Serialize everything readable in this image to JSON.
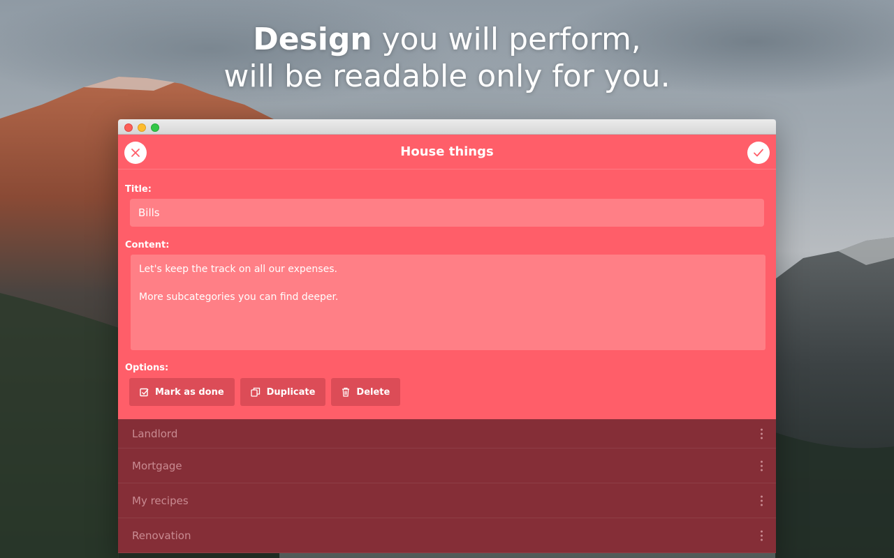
{
  "headline": {
    "bold": "Design",
    "line1_rest": " you will perform,",
    "line2": "will be readable only for you."
  },
  "window": {
    "header": {
      "title": "House things",
      "close_icon": "close-icon",
      "confirm_icon": "check-icon"
    },
    "form": {
      "title_label": "Title:",
      "title_value": "Bills",
      "content_label": "Content:",
      "content_lines": [
        "Let's keep the track on all our expenses.",
        "More subcategories you can find deeper."
      ],
      "options_label": "Options:",
      "options": [
        {
          "label": "Mark as done",
          "icon": "checkbox-icon"
        },
        {
          "label": "Duplicate",
          "icon": "duplicate-icon"
        },
        {
          "label": "Delete",
          "icon": "trash-icon"
        }
      ]
    },
    "list": [
      {
        "label": "Landlord"
      },
      {
        "label": "Mortgage"
      },
      {
        "label": "My recipes"
      },
      {
        "label": "Renovation"
      }
    ]
  },
  "colors": {
    "panel": "#ff5e69",
    "input": "#ff7f86",
    "option_button": "#dc4c57",
    "list_background": "#852e37"
  }
}
